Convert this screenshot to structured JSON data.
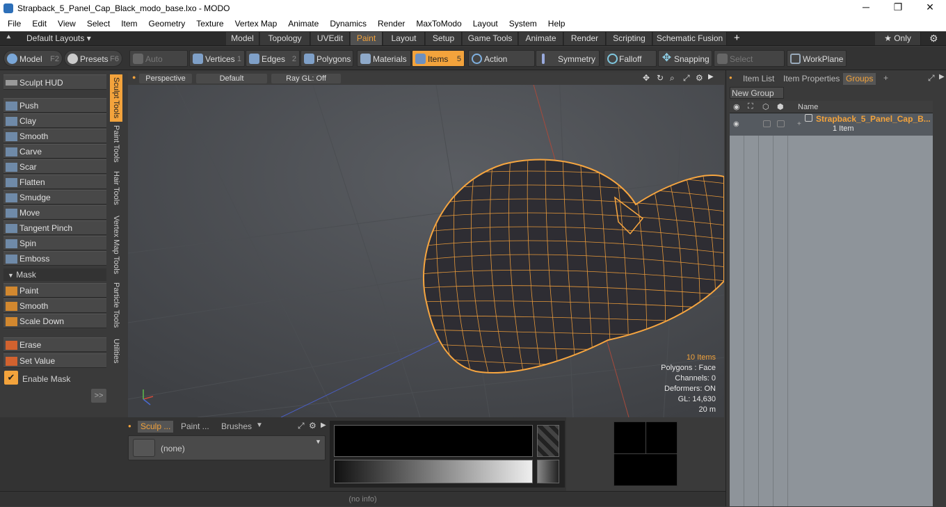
{
  "window": {
    "title": "Strapback_5_Panel_Cap_Black_modo_base.lxo - MODO",
    "minimize": "─",
    "maximize": "❐",
    "close": "✕"
  },
  "menu": [
    "File",
    "Edit",
    "View",
    "Select",
    "Item",
    "Geometry",
    "Texture",
    "Vertex Map",
    "Animate",
    "Dynamics",
    "Render",
    "MaxToModo",
    "Layout",
    "System",
    "Help"
  ],
  "layoutbar": {
    "layouts": "Default Layouts ▾",
    "tabs": [
      "Model",
      "Topology",
      "UVEdit",
      "Paint",
      "Layout",
      "Setup",
      "Game Tools",
      "Animate",
      "Render",
      "Scripting",
      "Schematic Fusion"
    ],
    "active": "Paint",
    "add": "+",
    "only": "★  Only",
    "gear": "⚙"
  },
  "toolbar": {
    "model": "Model",
    "model_key": "F2",
    "presets": "Presets",
    "presets_key": "F6",
    "auto_select": "Auto Select",
    "vertices": "Vertices",
    "vertices_key": "1",
    "edges": "Edges",
    "edges_key": "2",
    "polygons": "Polygons",
    "materials": "Materials",
    "items": "Items",
    "items_key": "5",
    "action_center": "Action Center",
    "symmetry": "Symmetry",
    "falloff": "Falloff",
    "snapping": "Snapping",
    "select_through": "Select Through",
    "workplane": "WorkPlane"
  },
  "left": {
    "hud": "Sculpt HUD",
    "tools": [
      "Push",
      "Clay",
      "Smooth",
      "Carve",
      "Scar",
      "Flatten",
      "Smudge",
      "Move",
      "Tangent Pinch",
      "Spin",
      "Emboss"
    ],
    "mask_header": "Mask",
    "mask_tools": [
      "Paint",
      "Smooth",
      "Scale Down"
    ],
    "edit_tools": [
      "Erase",
      "Set Value"
    ],
    "enable_mask": "Enable Mask",
    "expand": ">>",
    "vtabs": [
      "Sculpt Tools",
      "Paint Tools",
      "Hair Tools",
      "Vertex Map Tools",
      "Particle Tools",
      "Utilities"
    ]
  },
  "viewport": {
    "view": "Perspective",
    "shading": "Default",
    "raygl": "Ray GL: Off",
    "stats": {
      "items": "10 Items",
      "polygons": "Polygons : Face",
      "channels": "Channels: 0",
      "deformers": "Deformers: ON",
      "gl": "GL: 14,630",
      "distance": "20 m"
    }
  },
  "right": {
    "tabs": [
      "Item List",
      "Item Properties",
      "Groups"
    ],
    "active": "Groups",
    "add": "+",
    "new_group": "New Group",
    "col_name": "Name",
    "group_name": "Strapback_5_Panel_Cap_B...",
    "group_count": "1 Item"
  },
  "bottom": {
    "tabs": [
      "Sculp ...",
      "Paint ...",
      "Brushes"
    ],
    "brush": "(none)"
  },
  "status": "(no info)",
  "colors": {
    "accent": "#f3a33c",
    "wire": "#f7a640",
    "mesh": "#2e2d33"
  }
}
